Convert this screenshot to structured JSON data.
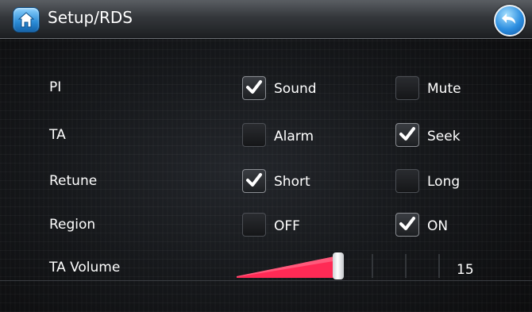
{
  "header": {
    "title": "Setup/RDS"
  },
  "rows": [
    {
      "label": "PI",
      "options": [
        {
          "label": "Sound",
          "checked": true
        },
        {
          "label": "Mute",
          "checked": false
        }
      ]
    },
    {
      "label": "TA",
      "options": [
        {
          "label": "Alarm",
          "checked": false
        },
        {
          "label": "Seek",
          "checked": true
        }
      ]
    },
    {
      "label": "Retune",
      "options": [
        {
          "label": "Short",
          "checked": true
        },
        {
          "label": "Long",
          "checked": false
        }
      ]
    },
    {
      "label": "Region",
      "options": [
        {
          "label": "OFF",
          "checked": false
        },
        {
          "label": "ON",
          "checked": true
        }
      ]
    }
  ],
  "ta_volume": {
    "label": "TA Volume",
    "value": "15",
    "level": 0.5
  },
  "colors": {
    "accent": "#ff2a55",
    "icon_blue": "#2a8bd6"
  },
  "icons": {
    "home": "home-icon",
    "back": "back-arrow-icon",
    "check": "checkmark-icon"
  }
}
